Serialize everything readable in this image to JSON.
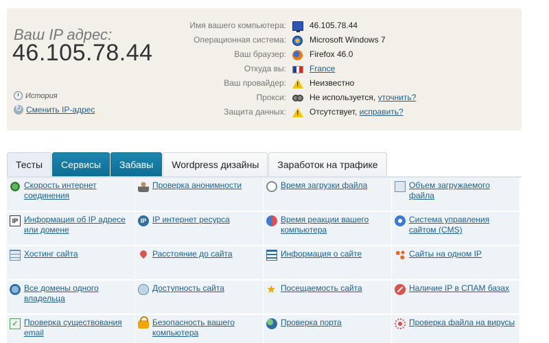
{
  "ip_panel": {
    "label": "Ваш IP адрес:",
    "ip": "46.105.78.44",
    "history_label": "История",
    "change_link": "Сменить IP-адрес"
  },
  "info": [
    {
      "key": "Имя вашего компьютера:",
      "icon": "monitor-icon",
      "value": "46.105.78.44"
    },
    {
      "key": "Операционная система:",
      "icon": "windows-icon",
      "value": "Microsoft Windows 7"
    },
    {
      "key": "Ваш браузер:",
      "icon": "firefox-icon",
      "value": "Firefox 46.0"
    },
    {
      "key": "Откуда вы:",
      "icon": "france-flag-icon",
      "value": "France"
    },
    {
      "key": "Ваш провайдер:",
      "icon": "warning-icon",
      "value": "Неизвестно"
    },
    {
      "key": "Прокси:",
      "icon": "glasses-icon",
      "value": "Не используется,",
      "link": "уточнить?"
    },
    {
      "key": "Защита данных:",
      "icon": "warning-icon",
      "value": "Отсутствует,",
      "link": "исправить?"
    }
  ],
  "tabs": [
    {
      "label": "Тесты"
    },
    {
      "label": "Сервисы"
    },
    {
      "label": "Забавы"
    },
    {
      "label": "Wordpress дизайны"
    },
    {
      "label": "Заработок на трафике"
    }
  ],
  "colors": {
    "panel_bg": "#f3efe9",
    "link": "#1e5f8a",
    "tab_active": "#0f6d93",
    "cell_bg": "#eef3f7"
  },
  "services": [
    {
      "label": "Скорость интернет соединения",
      "icon": "speed-icon"
    },
    {
      "label": "Проверка анонимности",
      "icon": "person-icon"
    },
    {
      "label": "Время загрузки файла",
      "icon": "clock-icon"
    },
    {
      "label": "Объем загружаемого файла",
      "icon": "document-icon"
    },
    {
      "label": "Информация об IP адресе или домене",
      "icon": "ip-box-icon"
    },
    {
      "label": "IP интернет ресурса",
      "icon": "ip-ball-icon"
    },
    {
      "label": "Время реакции вашего компьютера",
      "icon": "reload-icon"
    },
    {
      "label": "Система управления сайтом (CMS)",
      "icon": "gear-icon"
    },
    {
      "label": "Хостинг сайта",
      "icon": "table-icon"
    },
    {
      "label": "Расстояние до сайта",
      "icon": "pin-icon"
    },
    {
      "label": "Информация о сайте",
      "icon": "list-icon"
    },
    {
      "label": "Сайты на одном IP",
      "icon": "nodes-icon"
    },
    {
      "label": "Все домены одного владельца",
      "icon": "globe-icon"
    },
    {
      "label": "Доступность сайта",
      "icon": "alien-icon"
    },
    {
      "label": "Посещаемость сайта",
      "icon": "star-icon"
    },
    {
      "label": "Наличие IP в СПАМ базах",
      "icon": "no-entry-icon"
    },
    {
      "label": "Проверка существования email",
      "icon": "check-icon"
    },
    {
      "label": "Безопасность вашего компьютера",
      "icon": "lock-icon"
    },
    {
      "label": "Проверка порта",
      "icon": "globe-port-icon"
    },
    {
      "label": "Проверка файла на вирусы",
      "icon": "virus-icon"
    }
  ]
}
